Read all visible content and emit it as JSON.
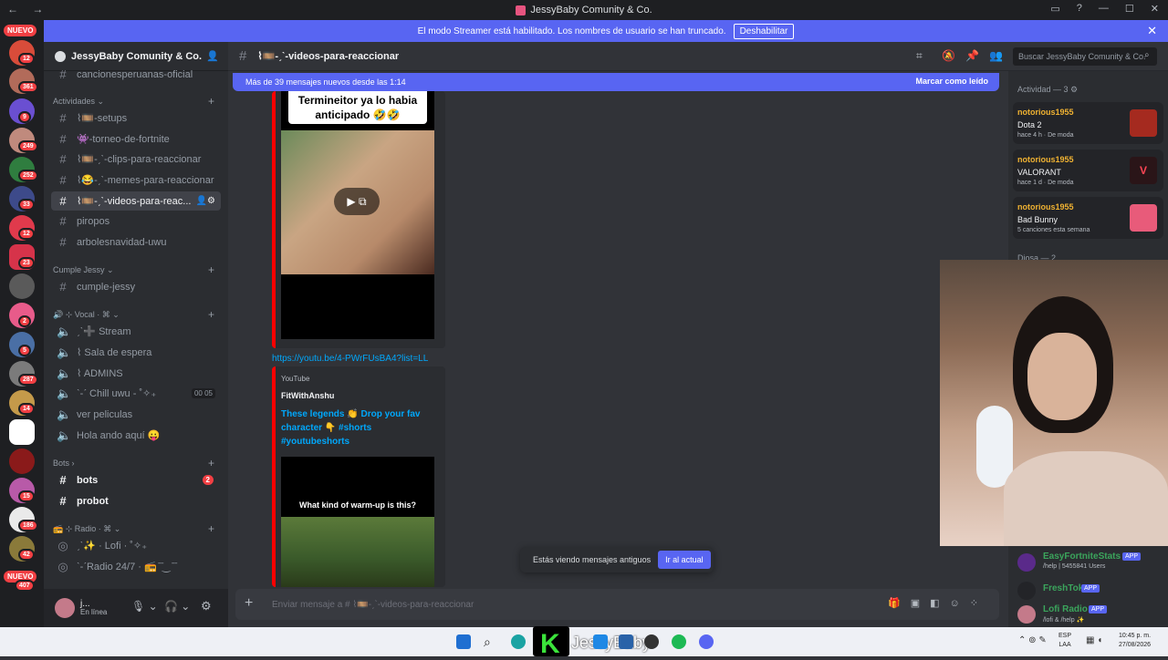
{
  "window": {
    "title": "JessyBaby Comunity & Co."
  },
  "banner": {
    "text": "El modo Streamer está habilitado. Los nombres de usuario se han truncado.",
    "button": "Deshabilitar"
  },
  "rail": {
    "nuevo_top": "NUEVO",
    "nuevo_bottom": "NUEVO",
    "badges": [
      "12",
      "361",
      "9",
      "249",
      "252",
      "33",
      "12",
      "23",
      "2",
      "5",
      "287",
      "14",
      "15",
      "186",
      "42",
      "407"
    ]
  },
  "server": {
    "name": "JessyBaby Comunity & Co."
  },
  "sidebar": {
    "top_channel": "cancionesperuanas-oficial",
    "cat_actividades": "Actividades",
    "channels_act": [
      "⌇🎞️-setups",
      "👾-torneo-de-fortnite",
      "⌇🎞️-ˏˋ-clips-para-reaccionar",
      "⌇😂-ˏˋ-memes-para-reaccionar",
      "⌇🎞️-ˏˋ-videos-para-reac...",
      "piropos",
      "arbolesnavidad-uwu"
    ],
    "cat_cumple": "Cumple Jessy",
    "channels_cumple": [
      "cumple-jessy"
    ],
    "cat_vocal": "🔊 ⊹ Vocal · ⌘",
    "voice": [
      "ˏˋ➕ Stream",
      "⌇ Sala de espera",
      "⌇ ADMINS",
      "ˋ-ˊ Chill uwu - ˚✧₊",
      "ver peliculas",
      "Hola ando aquí 😛"
    ],
    "chill_counts": [
      "00",
      "05"
    ],
    "cat_bots": "Bots",
    "channels_bots": [
      "bots",
      "probot"
    ],
    "bots_badge": "2",
    "cat_radio": "📻 ⊹ Radio · ⌘",
    "radio": [
      "ˏˋ✨ · Lofi · ˚✧₊",
      "ˋ-ˊRadio 24/7 · 📻 ̄ ̄‿ ̄ ̄"
    ]
  },
  "user": {
    "name": "j...",
    "status": "En línea"
  },
  "header": {
    "channel": "⌇🎞️-ˏˋ-videos-para-reaccionar",
    "search_placeholder": "Buscar JessyBaby Comunity & Co."
  },
  "newbar": {
    "text": "Más de 39 mensajes nuevos desde las 1:14",
    "mark": "Marcar como leído"
  },
  "embed1": {
    "caption1": "Termineitor ya lo habia",
    "caption2": "anticipado 🤣🤣"
  },
  "link": "https://youtu.be/4-PWrFUsBA4?list=LL",
  "embed2": {
    "provider": "YouTube",
    "author": "FitWithAnshu",
    "title": "These legends 👏 Drop your fav character 👇 #shorts #youtubeshorts",
    "thumb_text": "What kind of warm-up is this?",
    "thumb_highlight": "warm-up"
  },
  "toast": {
    "text": "Estás viendo mensajes antiguos",
    "button": "Ir al actual"
  },
  "composer": {
    "placeholder": "Enviar mensaje a # ⌇🎞️-ˏˋ-videos-para-reaccionar"
  },
  "members": {
    "activity_header": "Actividad — 3",
    "activities": [
      {
        "user": "notorious1955",
        "game": "Dota 2",
        "meta": "hace 4 h · De moda"
      },
      {
        "user": "notorious1955",
        "game": "VALORANT",
        "meta": "hace 1 d · De moda"
      },
      {
        "user": "notorious1955",
        "game": "Bad Bunny",
        "meta": "5 canciones esta semana"
      }
    ],
    "diosa_header": "Diosa — 2",
    "apps": [
      {
        "name": "EasyFortniteStats",
        "tag": "APP",
        "sub": "/help | 5455841 Users"
      },
      {
        "name": "FreshTok",
        "tag": "APP",
        "sub": ""
      },
      {
        "name": "Lofi Radio",
        "tag": "APP",
        "sub": "/lofi & /help ✨"
      }
    ]
  },
  "taskbar": {
    "lang": "ESP",
    "lang2": "LAA",
    "time": "10:45 p. m.",
    "date": "27/08/2026",
    "overlay": "JessyBaby"
  },
  "colors": {
    "accent": "#5865f2",
    "badge": "#f23f43",
    "bg": "#313338"
  }
}
